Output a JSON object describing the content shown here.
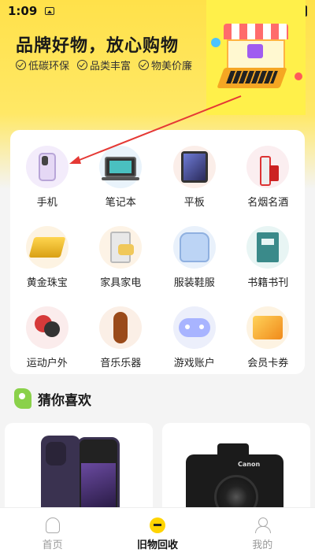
{
  "status_bar": {
    "time": "1:09"
  },
  "hero": {
    "title": "品牌好物，放心购物",
    "tags": [
      "低碳环保",
      "品类丰富",
      "物美价廉"
    ]
  },
  "categories": [
    {
      "label": "手机",
      "icon": "phone-icon",
      "bg": "#f3ecfb"
    },
    {
      "label": "笔记本",
      "icon": "laptop-icon",
      "bg": "#e9f3fb"
    },
    {
      "label": "平板",
      "icon": "tablet-icon",
      "bg": "#fbeee9"
    },
    {
      "label": "名烟名酒",
      "icon": "liquor-icon",
      "bg": "#fbeef0"
    },
    {
      "label": "黄金珠宝",
      "icon": "gold-icon",
      "bg": "#fdf3e2"
    },
    {
      "label": "家具家电",
      "icon": "appliance-icon",
      "bg": "#fdf3e6"
    },
    {
      "label": "服装鞋服",
      "icon": "clothing-icon",
      "bg": "#e9f1fb"
    },
    {
      "label": "书籍书刊",
      "icon": "book-icon",
      "bg": "#e8f5f4"
    },
    {
      "label": "运动户外",
      "icon": "sports-icon",
      "bg": "#fbecec"
    },
    {
      "label": "音乐乐器",
      "icon": "instrument-icon",
      "bg": "#fbefe6"
    },
    {
      "label": "游戏账户",
      "icon": "game-icon",
      "bg": "#eceffb"
    },
    {
      "label": "会员卡券",
      "icon": "voucher-icon",
      "bg": "#fdf3e2"
    }
  ],
  "guess": {
    "title": "猜你喜欢"
  },
  "products": [
    {
      "name": "iphone-product",
      "icon": "iphone-image"
    },
    {
      "name": "camera-product",
      "icon": "camera-image",
      "brand": "Canon"
    }
  ],
  "bottom_nav": [
    {
      "label": "首页",
      "icon": "bulb-icon",
      "active": false
    },
    {
      "label": "旧物回收",
      "icon": "recycle-icon",
      "active": true
    },
    {
      "label": "我的",
      "icon": "user-icon",
      "active": false
    }
  ],
  "colors": {
    "accent": "#ffe14a",
    "annotation_arrow": "#e53935"
  }
}
